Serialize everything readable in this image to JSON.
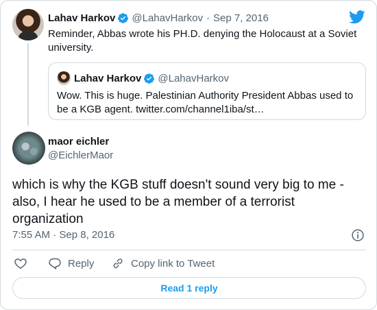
{
  "parent_tweet": {
    "author_name": "Lahav Harkov",
    "handle": "@LahavHarkov",
    "separator": "·",
    "date": "Sep 7, 2016",
    "text": "Reminder, Abbas wrote his PH.D. denying the Holocaust at a Soviet university."
  },
  "quoted_tweet": {
    "author_name": "Lahav Harkov",
    "handle": "@LahavHarkov",
    "text": "Wow. This is huge. Palestinian Authority President Abbas used to be a KGB agent.  twitter.com/channel1iba/st…"
  },
  "reply_tweet": {
    "author_name": "maor eichler",
    "handle": "@EichlerMaor",
    "text": "which is why the KGB stuff doesn't sound very big to me - also, I hear he used to be a member of a terrorist organization",
    "timestamp": "7:55 AM · Sep 8, 2016"
  },
  "actions": {
    "reply_label": "Reply",
    "copy_label": "Copy link to Tweet"
  },
  "read_replies_label": "Read 1 reply",
  "icons": {
    "brand": "twitter-bird-icon",
    "verified": "verified-badge-icon",
    "info": "info-icon",
    "like": "heart-icon",
    "reply": "reply-icon",
    "copy": "link-icon"
  },
  "colors": {
    "accent": "#1d9bf0",
    "muted_text": "#536471",
    "border": "#cfd9de",
    "text": "#0f1419"
  }
}
